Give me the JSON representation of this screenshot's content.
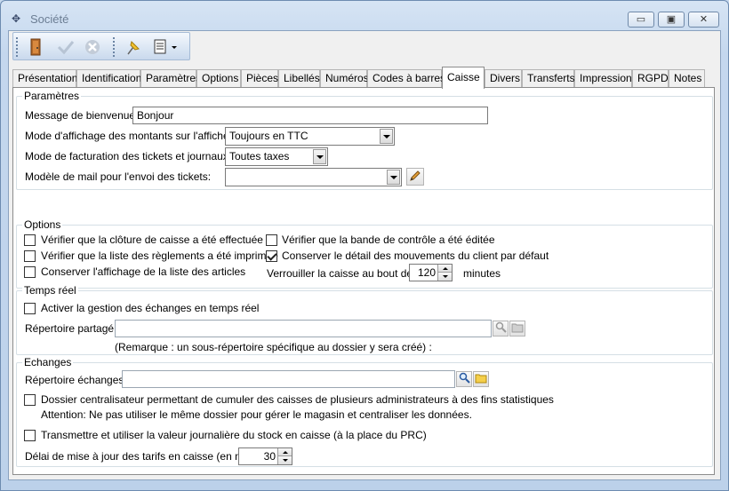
{
  "window": {
    "title": "Société",
    "minimize": "▭",
    "maximize": "▣",
    "close": "✕"
  },
  "toolbar": {
    "icons": [
      "door-exit-icon",
      "checkmark-icon",
      "cancel-icon",
      "pin-icon",
      "report-icon"
    ]
  },
  "tabs": [
    {
      "label": "Présentation"
    },
    {
      "label": "Identification"
    },
    {
      "label": "Paramètres"
    },
    {
      "label": "Options"
    },
    {
      "label": "Pièces"
    },
    {
      "label": "Libellés"
    },
    {
      "label": "Numéros"
    },
    {
      "label": "Codes à barres"
    },
    {
      "label": "Caisse",
      "active": true
    },
    {
      "label": "Divers"
    },
    {
      "label": "Transferts"
    },
    {
      "label": "Impressions"
    },
    {
      "label": "RGPD"
    },
    {
      "label": "Notes"
    }
  ],
  "parametres": {
    "legend": "Paramètres",
    "welcome_label": "Message de bienvenue :",
    "welcome_value": "Bonjour",
    "display_mode_label": "Mode d'affichage des montants sur l'afficheur :",
    "display_mode_value": "Toujours en TTC",
    "billing_mode_label": "Mode de facturation des tickets et journaux :",
    "billing_mode_value": "Toutes taxes",
    "mail_model_label": "Modèle de mail pour l'envoi des tickets:",
    "mail_model_value": ""
  },
  "options": {
    "legend": "Options",
    "cb1": "Vérifier que la clôture de caisse a été effectuée",
    "cb2": "Vérifier que la liste des règlements a été imprimée",
    "cb3": "Conserver l'affichage de la liste des articles",
    "cb4": "Vérifier que la bande de contrôle a été éditée",
    "cb5": "Conserver le détail des mouvements du client par défaut",
    "cb5_checked": true,
    "lock_label": "Verrouiller la caisse au bout de",
    "lock_value": "120",
    "lock_unit": "minutes"
  },
  "temps_reel": {
    "legend": "Temps réel",
    "cb_label": "Activer la gestion des échanges en temps réel",
    "dir_label": "Répertoire partagé :",
    "dir_value": "",
    "remark": "(Remarque : un sous-répertoire spécifique au dossier y sera créé) :"
  },
  "echanges": {
    "legend": "Echanges",
    "dir_label": "Répertoire échanges :",
    "dir_value": "",
    "cb1": "Dossier centralisateur permettant de cumuler des caisses de plusieurs administrateurs à des fins statistiques",
    "warning": "Attention: Ne pas utiliser le même dossier pour gérer le magasin et centraliser les données.",
    "cb2": "Transmettre et utiliser la valeur journalière du stock en caisse (à la place du PRC)",
    "delay_label": "Délai de mise à jour des tarifs en caisse (en mn):",
    "delay_value": "30"
  }
}
